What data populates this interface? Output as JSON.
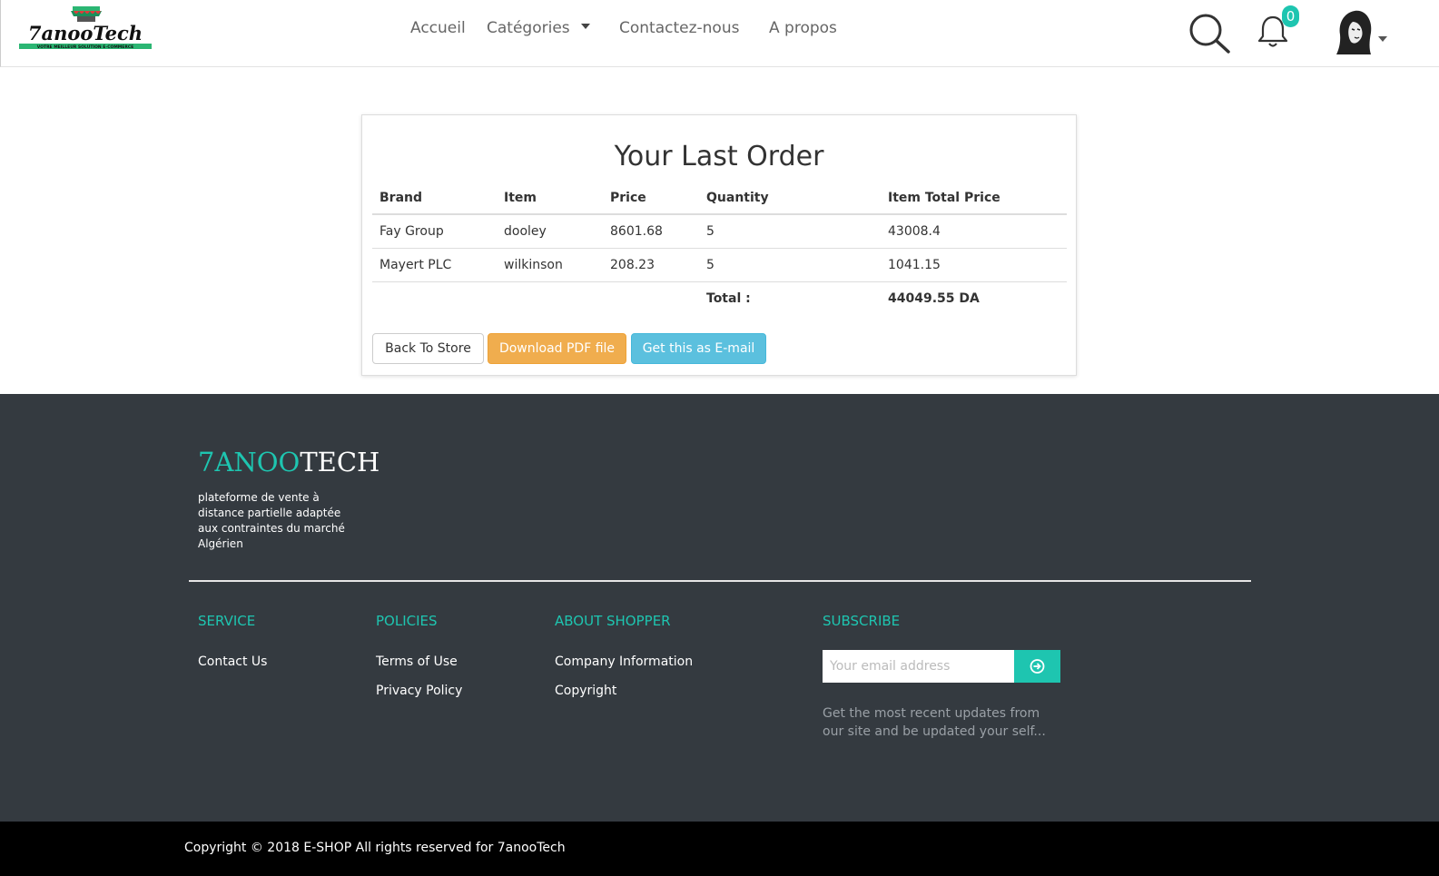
{
  "nav": {
    "logo_text": "7anooTech",
    "logo_tagline": "VOTRE MEILLEUR SOLUTION E-COMMERCE",
    "links": [
      "Accueil",
      "Catégories",
      "Contactez-nous",
      "A propos"
    ],
    "notification_count": "0",
    "icons": [
      "search-icon",
      "bell-icon",
      "avatar"
    ]
  },
  "order": {
    "title": "Your Last Order",
    "columns": [
      "Brand",
      "Item",
      "Price",
      "Quantity",
      "Item Total Price"
    ],
    "rows": [
      [
        "Fay Group",
        "dooley",
        "8601.68",
        "5",
        "43008.4"
      ],
      [
        "Mayert PLC",
        "wilkinson",
        "208.23",
        "5",
        "1041.15"
      ]
    ],
    "total_label": "Total :",
    "total_value": "44049.55 DA",
    "buttons": {
      "back": "Back To Store",
      "pdf": "Download PDF file",
      "email": "Get this as E-mail"
    }
  },
  "footer": {
    "brand_part1": "7ANOO",
    "brand_part2": "TECH",
    "tagline": "plateforme de vente à distance partielle adaptée aux contraintes du marché Algérien",
    "columns": {
      "service": {
        "title": "SERVICE",
        "links": [
          "Contact Us"
        ]
      },
      "policies": {
        "title": "POLICIES",
        "links": [
          "Terms of Use",
          "Privacy Policy"
        ]
      },
      "about": {
        "title": "ABOUT SHOPPER",
        "links": [
          "Company Information",
          "Copyright"
        ]
      },
      "subscribe": {
        "title": "SUBSCRIBE",
        "placeholder": "Your email address",
        "text": "Get the most recent updates from our site and be updated your self..."
      }
    },
    "copyright": "Copyright © 2018 E-SHOP All rights reserved for 7anooTech"
  },
  "colors": {
    "accent": "#1ec5b0",
    "footer_bg": "#343a40",
    "warning": "#f0ad4e",
    "info": "#5bc0de"
  }
}
